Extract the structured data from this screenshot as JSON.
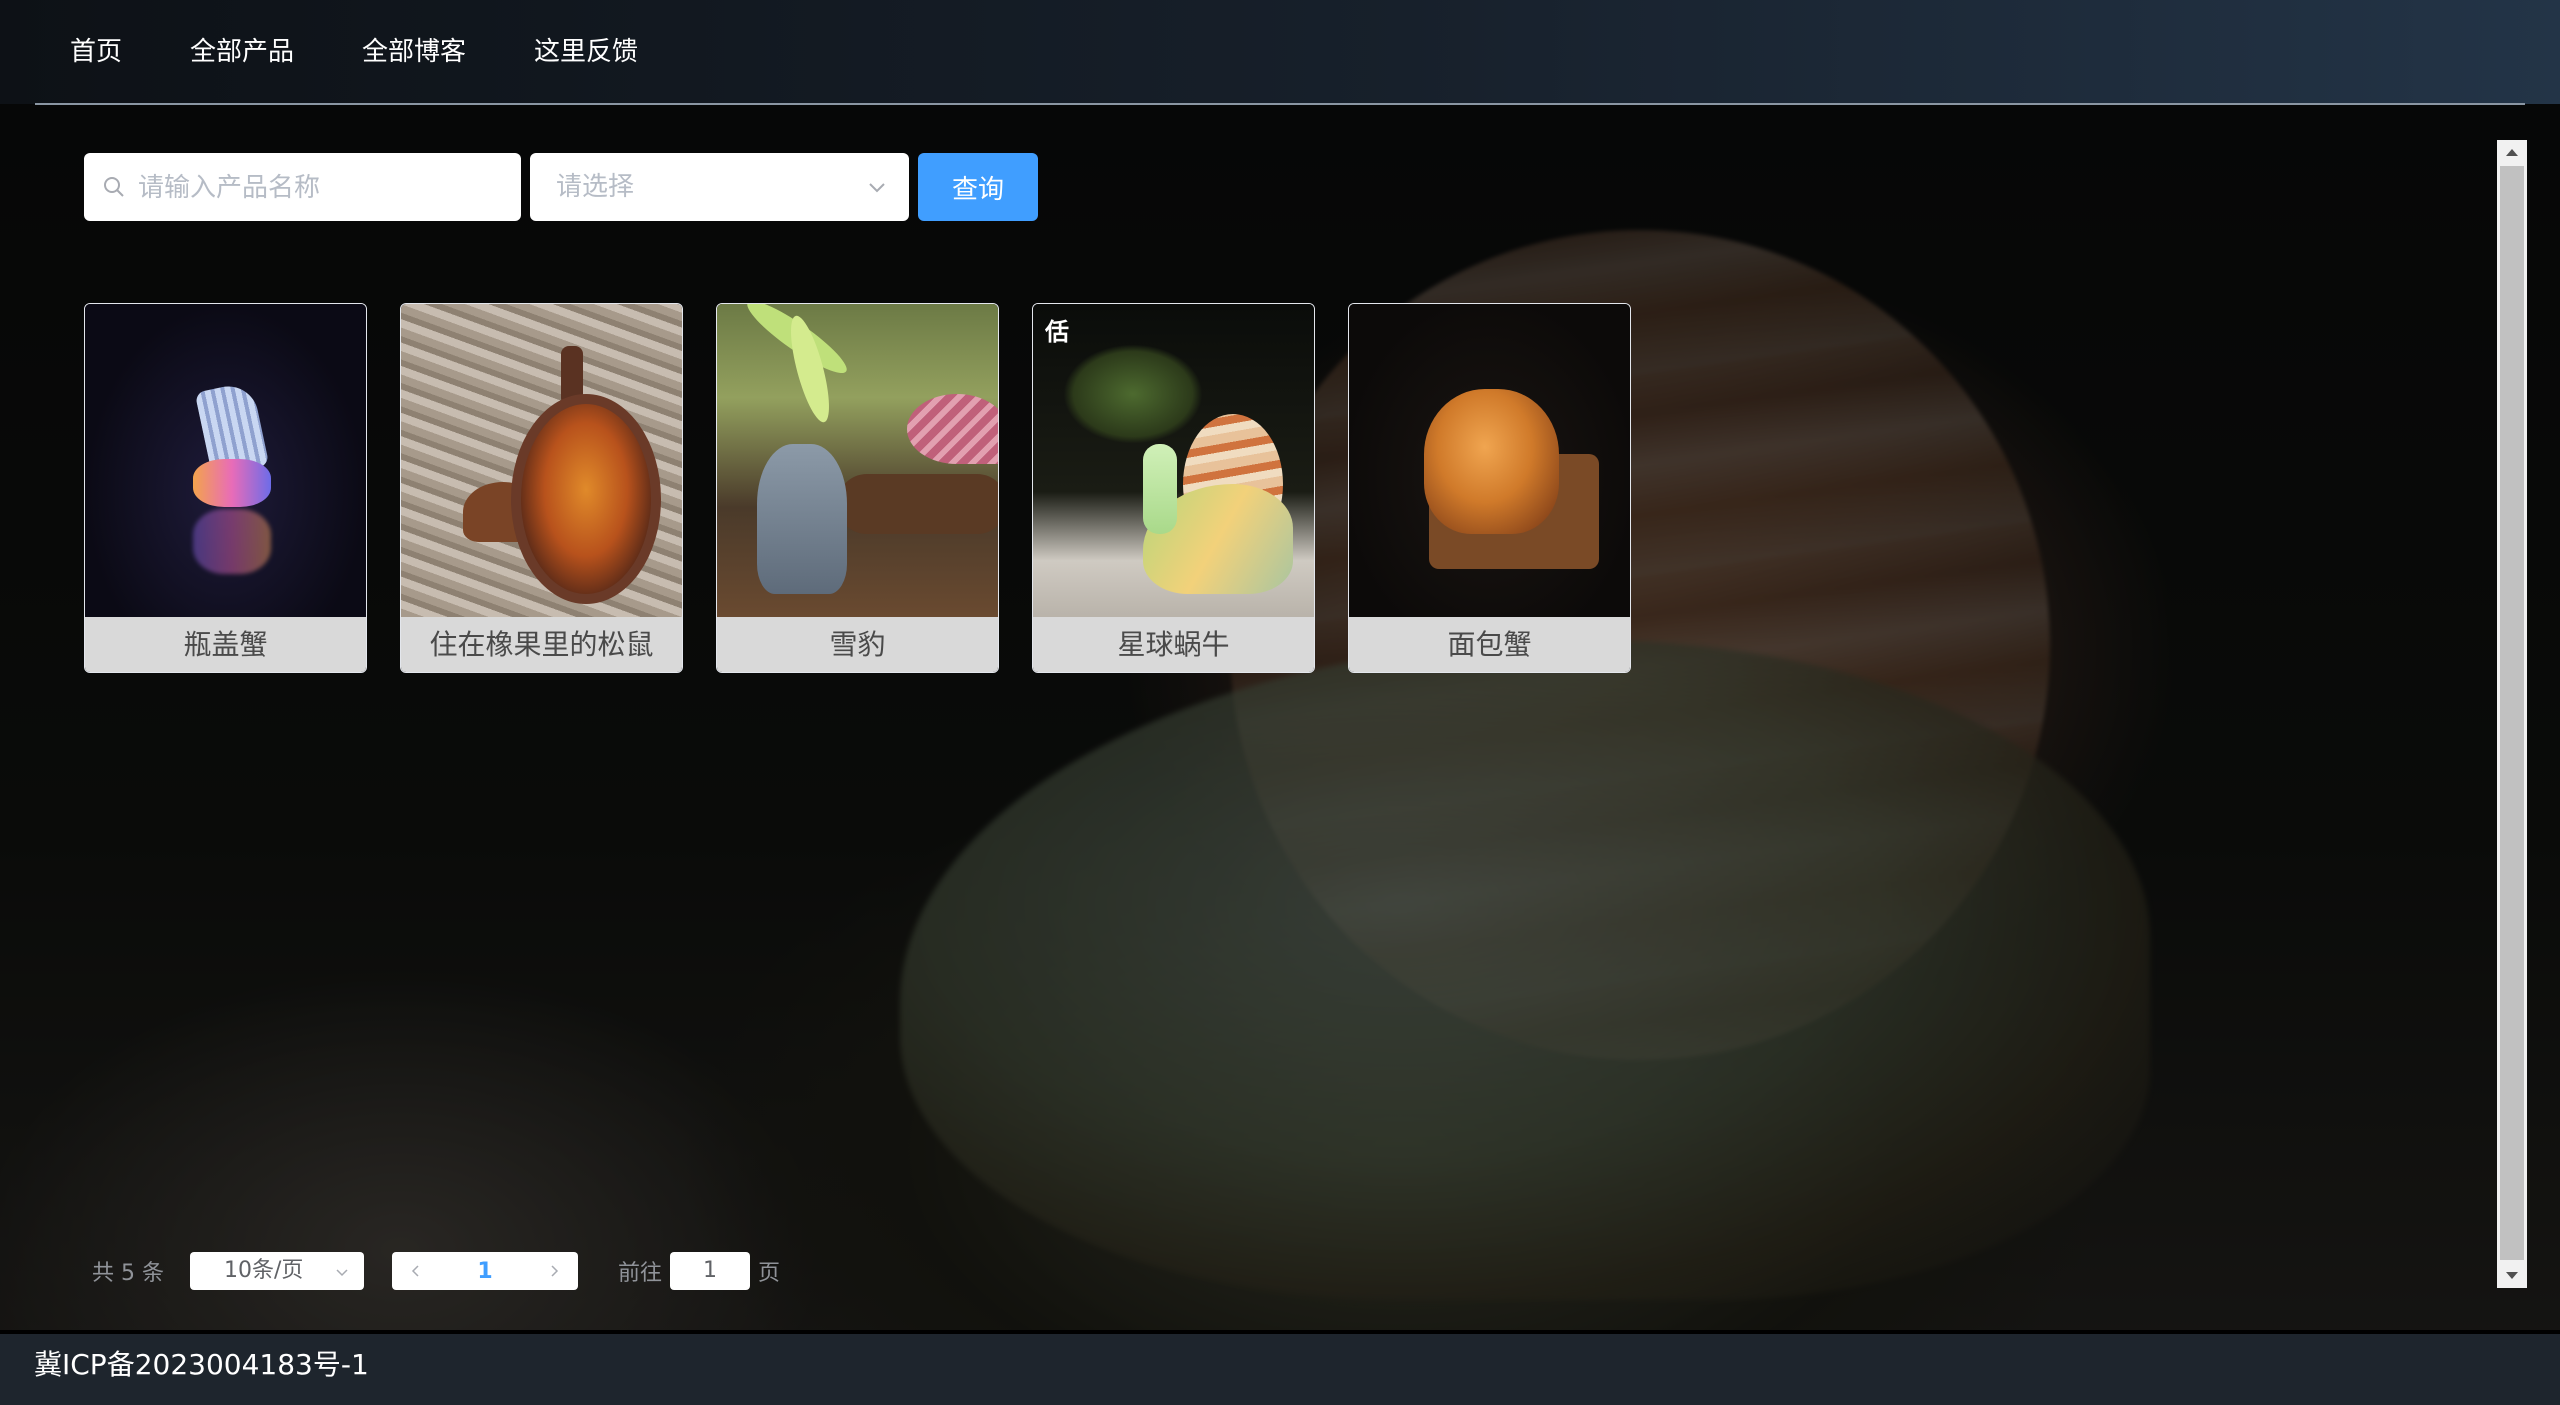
{
  "nav": {
    "items": [
      {
        "label": "首页"
      },
      {
        "label": "全部产品"
      },
      {
        "label": "全部博客"
      },
      {
        "label": "这里反馈"
      }
    ]
  },
  "search": {
    "placeholder": "请输入产品名称",
    "select_placeholder": "请选择",
    "query_label": "查询"
  },
  "products": [
    {
      "name": "瓶盖蟹"
    },
    {
      "name": "住在橡果里的松鼠"
    },
    {
      "name": "雪豹"
    },
    {
      "name": "星球蜗牛"
    },
    {
      "name": "面包蟹"
    }
  ],
  "pagination": {
    "total_text": "共 5 条",
    "page_size": "10条/页",
    "current_page": "1",
    "goto_label": "前往",
    "goto_value": "1",
    "page_suffix": "页"
  },
  "footer": {
    "icp": "冀ICP备2023004183号-1"
  },
  "colors": {
    "accent": "#409eff",
    "nav_bg": "#17202b",
    "footer_bg": "#1e252d"
  },
  "card4_logo": "佸"
}
